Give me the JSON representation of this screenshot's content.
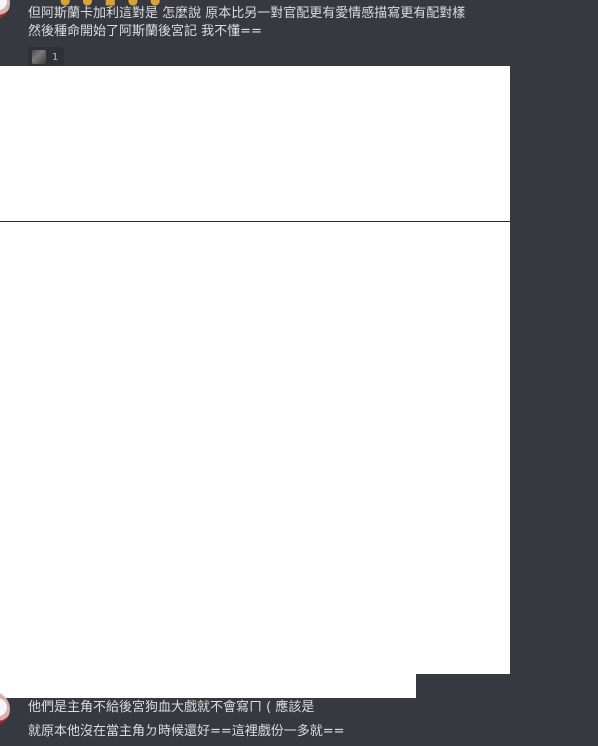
{
  "messages": [
    {
      "lines": [
        "但阿斯蘭卡加利這對是 怎麼說 原本比另一對官配更有愛情感描寫更有配對樣",
        "然後種命開始了阿斯蘭後宮記 我不懂=="
      ],
      "reaction": {
        "count": "1"
      }
    },
    {
      "lines": [
        "他們是主角不給後宮狗血大戲就不會寫ㄇ ( 應該是",
        "就原本他沒在當主角ㄉ時候還好==這裡戲份一多就=="
      ]
    }
  ]
}
